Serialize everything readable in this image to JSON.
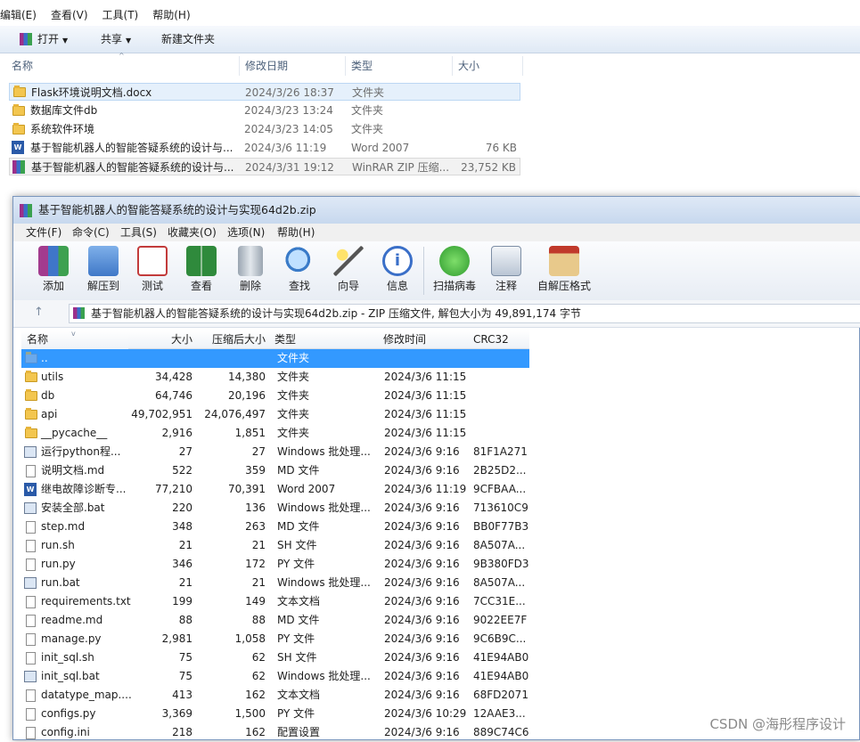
{
  "explorer": {
    "menu": [
      "编辑(E)",
      "查看(V)",
      "工具(T)",
      "帮助(H)"
    ],
    "toolbar": {
      "open": "打开",
      "share": "共享",
      "new_folder": "新建文件夹"
    },
    "columns": {
      "name": "名称",
      "date": "修改日期",
      "type": "类型",
      "size": "大小"
    },
    "rows": [
      {
        "name": "Flask环境说明文档.docx",
        "date": "2024/3/26 18:37",
        "type": "文件夹",
        "size": "",
        "icon": "folder-icon"
      },
      {
        "name": "数据库文件db",
        "date": "2024/3/23 13:24",
        "type": "文件夹",
        "size": "",
        "icon": "folder-icon"
      },
      {
        "name": "系统软件环境",
        "date": "2024/3/23 14:05",
        "type": "文件夹",
        "size": "",
        "icon": "folder-icon"
      },
      {
        "name": "基于智能机器人的智能答疑系统的设计与...",
        "date": "2024/3/6 11:19",
        "type": "Word 2007",
        "size": "76 KB",
        "icon": "word-doc-icon"
      },
      {
        "name": "基于智能机器人的智能答疑系统的设计与...",
        "date": "2024/3/31 19:12",
        "type": "WinRAR ZIP 压缩...",
        "size": "23,752 KB",
        "icon": "winrar-archive-icon"
      }
    ]
  },
  "winrar": {
    "title": "基于智能机器人的智能答疑系统的设计与实现64d2b.zip",
    "menu": [
      "文件(F)",
      "命令(C)",
      "工具(S)",
      "收藏夹(O)",
      "选项(N)",
      "帮助(H)"
    ],
    "tools": [
      "添加",
      "解压到",
      "测试",
      "查看",
      "删除",
      "查找",
      "向导",
      "信息",
      "扫描病毒",
      "注释",
      "自解压格式"
    ],
    "path": "基于智能机器人的智能答疑系统的设计与实现64d2b.zip - ZIP 压缩文件, 解包大小为 49,891,174 字节",
    "columns": {
      "name": "名称",
      "size": "大小",
      "packed": "压缩后大小",
      "type": "类型",
      "modified": "修改时间",
      "crc": "CRC32"
    },
    "rows": [
      {
        "name": "..",
        "size": "",
        "packed": "",
        "type": "文件夹",
        "modified": "",
        "crc": "",
        "icon": "parent-folder-icon"
      },
      {
        "name": "utils",
        "size": "34,428",
        "packed": "14,380",
        "type": "文件夹",
        "modified": "2024/3/6 11:15",
        "crc": "",
        "icon": "folder-icon"
      },
      {
        "name": "db",
        "size": "64,746",
        "packed": "20,196",
        "type": "文件夹",
        "modified": "2024/3/6 11:15",
        "crc": "",
        "icon": "folder-icon"
      },
      {
        "name": "api",
        "size": "49,702,951",
        "packed": "24,076,497",
        "type": "文件夹",
        "modified": "2024/3/6 11:15",
        "crc": "",
        "icon": "folder-icon"
      },
      {
        "name": "__pycache__",
        "size": "2,916",
        "packed": "1,851",
        "type": "文件夹",
        "modified": "2024/3/6 11:15",
        "crc": "",
        "icon": "folder-icon"
      },
      {
        "name": "运行python程...",
        "size": "27",
        "packed": "27",
        "type": "Windows 批处理...",
        "modified": "2024/3/6 9:16",
        "crc": "81F1A271",
        "icon": "batch-file-icon"
      },
      {
        "name": "说明文档.md",
        "size": "522",
        "packed": "359",
        "type": "MD 文件",
        "modified": "2024/3/6 9:16",
        "crc": "2B25D2...",
        "icon": "file-icon"
      },
      {
        "name": "继电故障诊断专...",
        "size": "77,210",
        "packed": "70,391",
        "type": "Word 2007",
        "modified": "2024/3/6 11:19",
        "crc": "9CFBAA...",
        "icon": "word-doc-icon"
      },
      {
        "name": "安装全部.bat",
        "size": "220",
        "packed": "136",
        "type": "Windows 批处理...",
        "modified": "2024/3/6 9:16",
        "crc": "713610C9",
        "icon": "batch-file-icon"
      },
      {
        "name": "step.md",
        "size": "348",
        "packed": "263",
        "type": "MD 文件",
        "modified": "2024/3/6 9:16",
        "crc": "BB0F77B3",
        "icon": "file-icon"
      },
      {
        "name": "run.sh",
        "size": "21",
        "packed": "21",
        "type": "SH 文件",
        "modified": "2024/3/6 9:16",
        "crc": "8A507A...",
        "icon": "file-icon"
      },
      {
        "name": "run.py",
        "size": "346",
        "packed": "172",
        "type": "PY 文件",
        "modified": "2024/3/6 9:16",
        "crc": "9B380FD3",
        "icon": "file-icon"
      },
      {
        "name": "run.bat",
        "size": "21",
        "packed": "21",
        "type": "Windows 批处理...",
        "modified": "2024/3/6 9:16",
        "crc": "8A507A...",
        "icon": "batch-file-icon"
      },
      {
        "name": "requirements.txt",
        "size": "199",
        "packed": "149",
        "type": "文本文档",
        "modified": "2024/3/6 9:16",
        "crc": "7CC31E...",
        "icon": "file-icon"
      },
      {
        "name": "readme.md",
        "size": "88",
        "packed": "88",
        "type": "MD 文件",
        "modified": "2024/3/6 9:16",
        "crc": "9022EE7F",
        "icon": "file-icon"
      },
      {
        "name": "manage.py",
        "size": "2,981",
        "packed": "1,058",
        "type": "PY 文件",
        "modified": "2024/3/6 9:16",
        "crc": "9C6B9C...",
        "icon": "file-icon"
      },
      {
        "name": "init_sql.sh",
        "size": "75",
        "packed": "62",
        "type": "SH 文件",
        "modified": "2024/3/6 9:16",
        "crc": "41E94AB0",
        "icon": "file-icon"
      },
      {
        "name": "init_sql.bat",
        "size": "75",
        "packed": "62",
        "type": "Windows 批处理...",
        "modified": "2024/3/6 9:16",
        "crc": "41E94AB0",
        "icon": "batch-file-icon"
      },
      {
        "name": "datatype_map....",
        "size": "413",
        "packed": "162",
        "type": "文本文档",
        "modified": "2024/3/6 9:16",
        "crc": "68FD2071",
        "icon": "file-icon"
      },
      {
        "name": "configs.py",
        "size": "3,369",
        "packed": "1,500",
        "type": "PY 文件",
        "modified": "2024/3/6 10:29",
        "crc": "12AAE3...",
        "icon": "file-icon"
      },
      {
        "name": "config.ini",
        "size": "218",
        "packed": "162",
        "type": "配置设置",
        "modified": "2024/3/6 9:16",
        "crc": "889C74C6",
        "icon": "file-icon"
      }
    ]
  },
  "watermark": "CSDN @海彤程序设计"
}
